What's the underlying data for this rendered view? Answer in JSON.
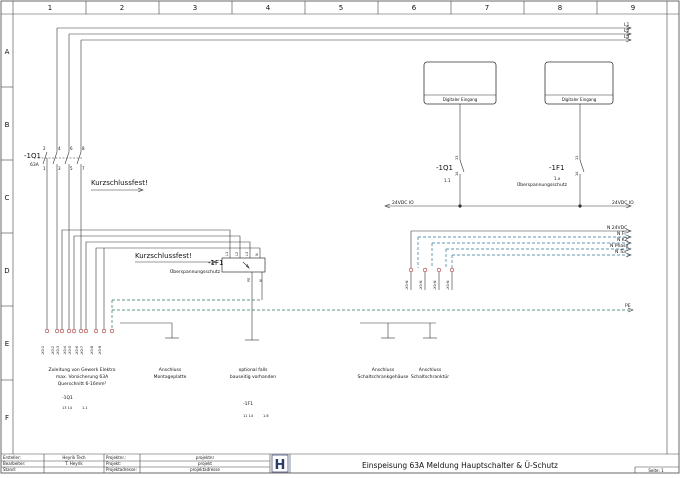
{
  "columns": [
    "1",
    "2",
    "3",
    "4",
    "5",
    "6",
    "7",
    "8",
    "9"
  ],
  "rows": [
    "A",
    "B",
    "C",
    "D",
    "E",
    "F"
  ],
  "bus_top": [
    "L1",
    "L2",
    "L3"
  ],
  "bus_mid": [
    "N 24VDC",
    "N Fl",
    "N KZ",
    "N Phase",
    "N Tür"
  ],
  "pe_label": "PE",
  "dc_label": "24VDC IO",
  "dc_label_right": "24VDC IO",
  "main_switch": {
    "tag": "-1Q1",
    "rating": "63A",
    "pins_top": [
      "2",
      "4",
      "6",
      "8"
    ],
    "pins_bottom": [
      "1",
      "3",
      "5",
      "7"
    ]
  },
  "note_short_circuit": "Kurzschlussfest!",
  "note_short_circuit_2": "Kurzschlussfest!",
  "surge": {
    "tag": "-1F1",
    "desc": "Überspannungsschutz",
    "terminals": [
      "L1",
      "L2",
      "L3",
      "N",
      "PE"
    ],
    "pins_bottom": [
      "PE",
      "N"
    ]
  },
  "digital_in_1": {
    "label": "Digitaler Eingang",
    "tag": "-1Q1",
    "sub": "1.1",
    "pins": [
      "13",
      "14"
    ]
  },
  "digital_in_2": {
    "label": "Digitaler Eingang",
    "tag": "-1F1",
    "sub": "1.x",
    "desc": "Überspannungsschutz",
    "pins": [
      "11",
      "14"
    ]
  },
  "mid_drops": [
    "-X0:N",
    "-X0:N",
    "-X0:N",
    "-X0:N"
  ],
  "terminal_labels": [
    "-X0:1",
    "-X0:2",
    "-X0:3",
    "-X0:4",
    "-X0:5",
    "-X0:6",
    "-X0:7",
    "-X0:8",
    "-X0:9"
  ],
  "bottom_notes": [
    {
      "id": "supply",
      "lines": [
        "Zuleitung von Gewerk Elektro",
        "max. Vorsicherung 63A",
        "Querschnitt 6-16mm²"
      ]
    },
    {
      "id": "mount",
      "lines": [
        "Anschluss",
        "Montageplatte"
      ]
    },
    {
      "id": "optional",
      "lines": [
        "optional falls",
        "bauseitig vorhanden"
      ]
    },
    {
      "id": "cab",
      "lines": [
        "Anschluss",
        "Schaltschrankgehäuse"
      ]
    },
    {
      "id": "door",
      "lines": [
        "Anschluss",
        "Schaltschranktür"
      ]
    }
  ],
  "ref1": {
    "tag": "-1Q1",
    "detail": "13  14",
    "loc": "1.1"
  },
  "ref2": {
    "tag": "-1F1",
    "detail": "11  14",
    "loc": "1.6"
  },
  "title_block": {
    "rows": [
      {
        "label": "Ersteller:",
        "value": "Heyrik Tech"
      },
      {
        "label": "Bearbeiter:",
        "value": "T. Heyrik"
      },
      {
        "label": "Stand:",
        "value": ""
      }
    ],
    "project_rows": [
      {
        "label": "Projektnr.:",
        "value": "projektnr"
      },
      {
        "label": "Projekt:",
        "value": "projekt"
      },
      {
        "label": "Projektadresse:",
        "value": "projektadresse"
      }
    ],
    "logo_letter": "H",
    "title": "Einspeisung 63A Meldung Hauptschalter & Ü-Schutz",
    "page": "Seite: 1"
  }
}
